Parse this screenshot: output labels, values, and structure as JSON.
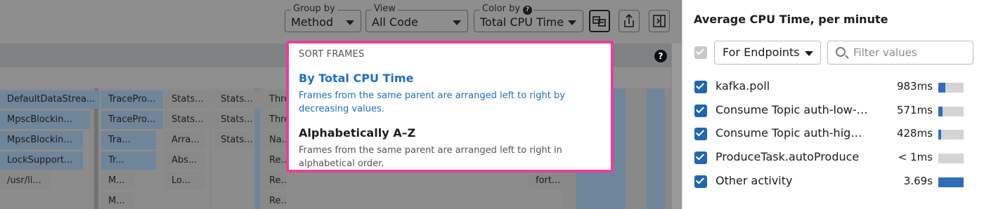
{
  "toolbar": {
    "group_by": {
      "label": "Group by",
      "value": "Method"
    },
    "view": {
      "label": "View",
      "value": "All Code"
    },
    "color_by": {
      "label": "Color by",
      "value": "Total CPU Time"
    }
  },
  "sort_menu": {
    "heading": "SORT FRAMES",
    "options": [
      {
        "title": "By Total CPU Time",
        "description": "Frames from the same parent are arranged left to right by decreasing values.",
        "selected": true
      },
      {
        "title": "Alphabetically A–Z",
        "description": "Frames from the same parent are arranged left to right in alphabetical order.",
        "selected": false
      }
    ]
  },
  "flame": {
    "frames": [
      "DefaultDataStrea...",
      "TracePro...",
      "Stats...",
      "Stats...",
      "Thre",
      "MpscBlockin...",
      "TracePro...",
      "Stats...",
      "Stats...",
      "Thre",
      "MpscBlockin...",
      "Tra...",
      "Arra...",
      "Stats...",
      "Na...",
      "LockSupport...",
      "Tr...",
      "Abs...",
      "Re...",
      "/usr/li...",
      "M...",
      "Lo...",
      "Re...",
      "fort...",
      "M...",
      "Re..."
    ]
  },
  "panel": {
    "title": "Average CPU Time, per minute",
    "scope": "For Endpoints",
    "filter_placeholder": "Filter values",
    "rows": [
      {
        "label": "kafka.poll",
        "value": "983ms",
        "fraction": 0.27
      },
      {
        "label": "Consume Topic auth-low-pr...",
        "value": "571ms",
        "fraction": 0.16
      },
      {
        "label": "Consume Topic auth-high-...",
        "value": "428ms",
        "fraction": 0.12
      },
      {
        "label": "ProduceTask.autoProduce",
        "value": "< 1ms",
        "fraction": 0.0
      },
      {
        "label": "Other activity",
        "value": "3.69s",
        "fraction": 1.0
      }
    ]
  },
  "colors": {
    "accent": "#1e6fbf",
    "highlight_border": "#e83e9d",
    "checkbox": "#2166b0",
    "bar_fill": "#2f6db8",
    "overlay_gray": "#8e8e8e"
  }
}
